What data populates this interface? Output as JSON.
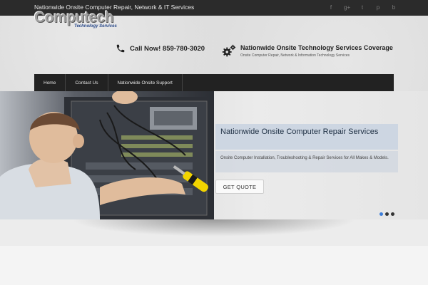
{
  "topbar": {
    "tagline": "Nationwide Onsite Computer Repair, Network & IT Services",
    "social_icons": [
      "facebook-icon",
      "google-plus-icon",
      "twitter-icon",
      "pinterest-icon",
      "blogger-icon"
    ]
  },
  "logo": {
    "name": "Computech",
    "subtitle": "Technology Services"
  },
  "call": {
    "icon": "phone-icon",
    "text": "Call Now! 859-780-3020"
  },
  "services": {
    "icon": "gears-icon",
    "title": "Nationwide Onsite Technology Services Coverage",
    "subtitle": "Onsite Computer Repair, Network & Information Technology Services"
  },
  "nav": {
    "items": [
      {
        "label": "Home"
      },
      {
        "label": "Contact Us"
      },
      {
        "label": "Nationwide Onsite Support"
      }
    ]
  },
  "slide": {
    "title": "Nationwide Onsite Computer Repair Services",
    "description": "Onsite Computer Installation, Troubleshooting & Repair Services for All Makes & Models.",
    "cta_label": "GET QUOTE",
    "active_dot": 1,
    "dot_count": 3
  },
  "colors": {
    "topbar_bg": "#2b2b2b",
    "nav_bg": "#222222",
    "active_dot": "#3c7dd9",
    "logo_subtitle": "#2a4a8a"
  }
}
